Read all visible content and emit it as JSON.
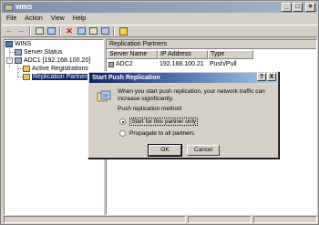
{
  "window": {
    "title": "WINS"
  },
  "titlebar_buttons": {
    "minimize": "_",
    "maximize": "□",
    "close": "×"
  },
  "menu": [
    "File",
    "Action",
    "View",
    "Help"
  ],
  "toolbar": {
    "icons": [
      "back-arrow-icon",
      "forward-arrow-icon",
      "up-folder-icon",
      "show-hide-tree-icon",
      "delete-icon",
      "properties-icon",
      "refresh-icon",
      "export-icon",
      "help-icon"
    ]
  },
  "tree": {
    "root": "WINS",
    "server_status": "Server Status",
    "server": "ADC1 [192.168.100.20]",
    "active_registrations": "Active Registrations",
    "replication_partners": "Replication Partners",
    "expander_symbol": "-"
  },
  "right_pane": {
    "header": "Replication Partners",
    "columns": [
      "Server Name",
      "IP Address",
      "Type"
    ],
    "rows": [
      {
        "server_name": "ADC2",
        "ip_address": "192.168.100.21",
        "type": "Push/Pull"
      }
    ]
  },
  "dialog": {
    "title": "Start Push Replication",
    "help_btn": "?",
    "close_btn": "X",
    "message": "When you start push replication, your network traffic can increase significantly.",
    "method_label": "Push replication method:",
    "options": [
      {
        "label": "Start for this partner only",
        "checked": true
      },
      {
        "label": "Propagate to all partners",
        "checked": false
      }
    ],
    "ok": "OK",
    "cancel": "Cancel"
  },
  "colors": {
    "title_bar_inactive": "#7f90a8",
    "dialog_title": "#0a246a",
    "selection": "#0a246a"
  }
}
